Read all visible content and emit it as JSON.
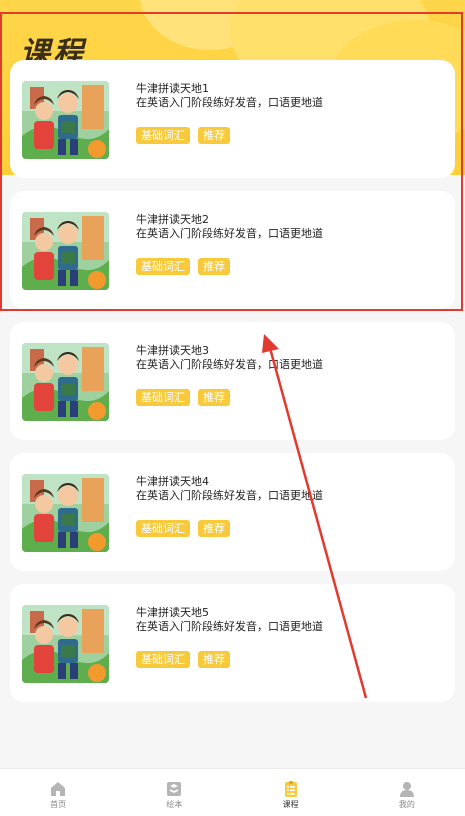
{
  "header": {
    "title": "课程"
  },
  "courses": [
    {
      "title": "牛津拼读天地1",
      "desc": "在英语入门阶段练好发音，口语更地道",
      "tags": [
        "基础词汇",
        "推荐"
      ]
    },
    {
      "title": "牛津拼读天地2",
      "desc": "在英语入门阶段练好发音，口语更地道",
      "tags": [
        "基础词汇",
        "推荐"
      ]
    },
    {
      "title": "牛津拼读天地3",
      "desc": "在英语入门阶段练好发音，口语更地道",
      "tags": [
        "基础词汇",
        "推荐"
      ]
    },
    {
      "title": "牛津拼读天地4",
      "desc": "在英语入门阶段练好发音，口语更地道",
      "tags": [
        "基础词汇",
        "推荐"
      ]
    },
    {
      "title": "牛津拼读天地5",
      "desc": "在英语入门阶段练好发音，口语更地道",
      "tags": [
        "基础词汇",
        "推荐"
      ]
    }
  ],
  "tabbar": {
    "items": [
      {
        "label": "首页",
        "icon": "home-icon"
      },
      {
        "label": "绘本",
        "icon": "picture-book-icon"
      },
      {
        "label": "课程",
        "icon": "course-list-icon",
        "active": true
      },
      {
        "label": "我的",
        "icon": "user-icon"
      }
    ]
  },
  "colors": {
    "accent": "#f7c93b",
    "header": "#ffd64a",
    "annotation": "#e23a2f"
  }
}
